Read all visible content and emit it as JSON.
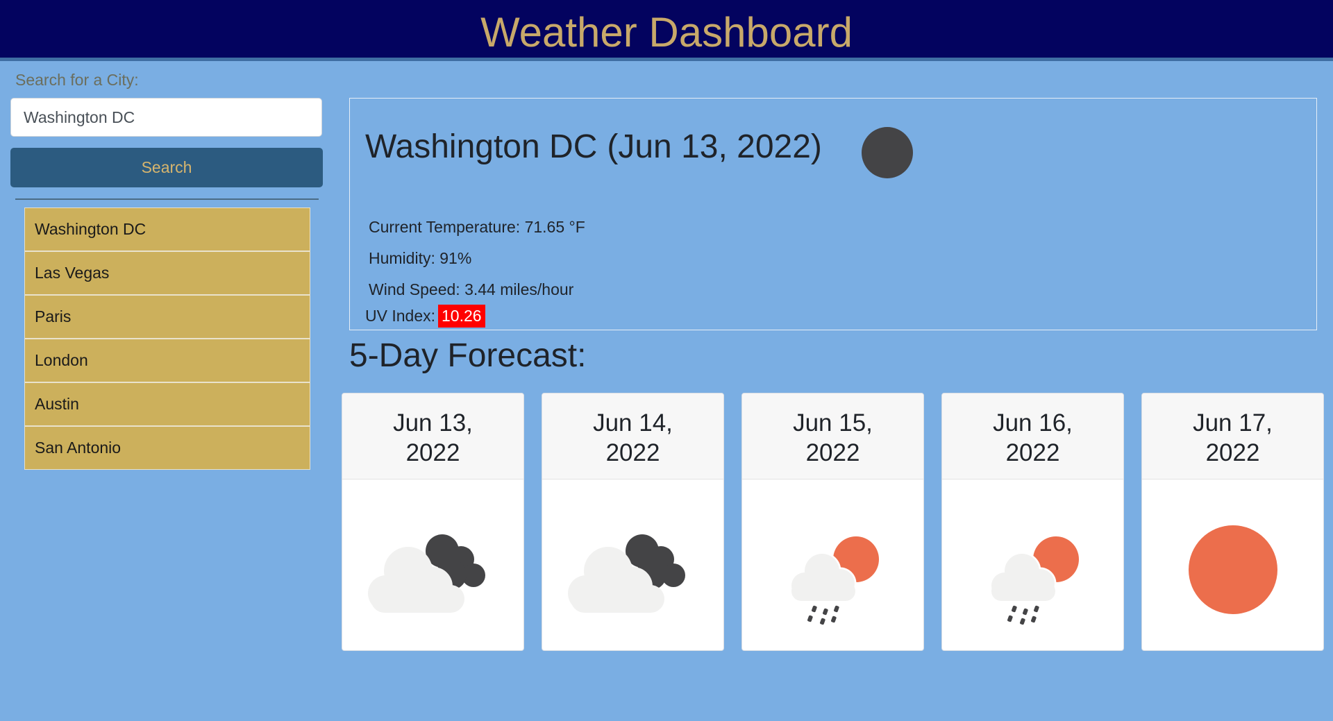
{
  "header": {
    "title": "Weather Dashboard"
  },
  "search": {
    "label": "Search for a City:",
    "value": "Washington DC",
    "button_label": "Search"
  },
  "history": [
    "Washington DC",
    "Las Vegas",
    "Paris",
    "London",
    "Austin",
    "San Antonio"
  ],
  "current": {
    "city": "Washington DC",
    "date": "(Jun 13, 2022)",
    "icon": "dark-circle-icon",
    "temperature": "Current Temperature: 71.65 °F",
    "humidity": "Humidity: 91%",
    "wind": "Wind Speed: 3.44 miles/hour",
    "uv_label": "UV Index:",
    "uv_value": "10.26",
    "uv_color": "#ff0000"
  },
  "forecast": {
    "heading": "5-Day Forecast:",
    "days": [
      {
        "date_line1": "Jun 13,",
        "date_line2": "2022",
        "icon": "cloudy-night-icon"
      },
      {
        "date_line1": "Jun 14,",
        "date_line2": "2022",
        "icon": "cloudy-night-icon"
      },
      {
        "date_line1": "Jun 15,",
        "date_line2": "2022",
        "icon": "sun-cloud-rain-icon"
      },
      {
        "date_line1": "Jun 16,",
        "date_line2": "2022",
        "icon": "sun-cloud-rain-icon"
      },
      {
        "date_line1": "Jun 17,",
        "date_line2": "2022",
        "icon": "sun-icon"
      }
    ]
  },
  "colors": {
    "background": "#7aaee3",
    "header_bg": "#03035f",
    "title": "#c8a96a",
    "button_bg": "#2c5b80",
    "history_bg": "#ccb05c",
    "sun": "#ec6e4c"
  }
}
